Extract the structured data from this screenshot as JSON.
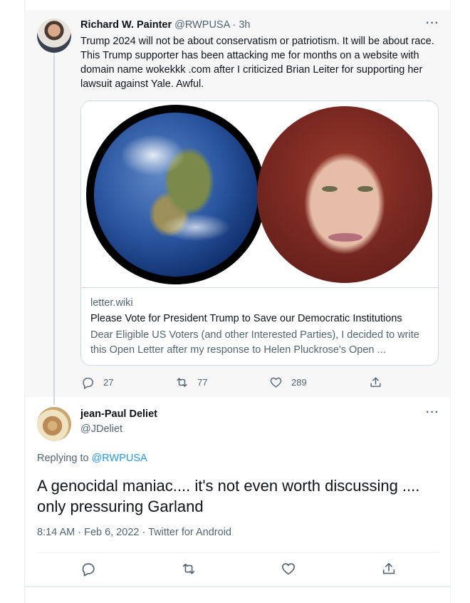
{
  "parent_tweet": {
    "author_name": "Richard W. Painter",
    "author_handle": "@RWPUSA",
    "time_ago": "· 3h",
    "text": "Trump 2024 will not be about conservatism or patriotism. It will be about race. This Trump supporter has been attacking me for months on a website with domain name wokekkk .com after I criticized Brian Leiter for supporting her lawsuit against Yale. Awful.",
    "more_icon": "more-horizontal-icon",
    "card": {
      "domain": "letter.wiki",
      "title": "Please Vote for President Trump to Save our Democratic Institutions",
      "description": "Dear Eligible US Voters (and other Interested Parties), I decided to write this Open Letter after my response to Helen Pluckrose's Open ..."
    },
    "actions": {
      "reply_count": "27",
      "retweet_count": "77",
      "like_count": "289"
    }
  },
  "reply_tweet": {
    "author_name": "jean-Paul Deliet",
    "author_handle": "@JDeliet",
    "replying_prefix": "Replying to",
    "replying_handle": "@RWPUSA",
    "text": "A genocidal maniac.... it's not even worth discussing .... only pressuring Garland",
    "meta": "8:14 AM · Feb 6, 2022 · Twitter for Android",
    "more_icon": "more-horizontal-icon"
  },
  "colors": {
    "text_primary": "#0f1419",
    "text_secondary": "#536471",
    "accent": "#1d9bf0",
    "parent_background": "#f7f7f7"
  }
}
